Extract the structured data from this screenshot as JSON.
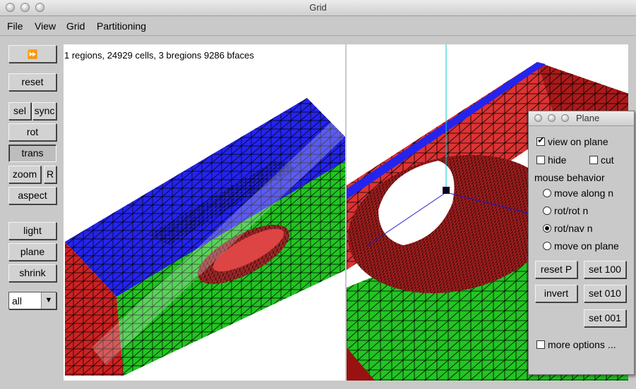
{
  "window": {
    "title": "Grid"
  },
  "menubar": {
    "items": [
      "File",
      "View",
      "Grid",
      "Partitioning"
    ]
  },
  "toolbar": {
    "play_glyph": "⏩",
    "reset": "reset",
    "sel": "sel",
    "sync": "sync",
    "rot": "rot",
    "trans": "trans",
    "zoom": "zoom",
    "r": "R",
    "aspect": "aspect",
    "light": "light",
    "plane": "plane",
    "shrink": "shrink",
    "filter_value": "all",
    "filter_arrow": "▼"
  },
  "viewport_left": {
    "status": "1 regions, 24929 cells, 3 bregions 9286 bfaces"
  },
  "plane_panel": {
    "title": "Plane",
    "view_on_plane": "view on plane",
    "view_on_plane_checked": true,
    "hide": "hide",
    "hide_checked": false,
    "cut": "cut",
    "cut_checked": false,
    "mouse_behavior_label": "mouse behavior",
    "modes": [
      "move along n",
      "rot/rot n",
      "rot/nav n",
      "move on plane"
    ],
    "selected_mode": "rot/nav n",
    "reset_p": "reset P",
    "set_100": "set 100",
    "invert": "invert",
    "set_010": "set 010",
    "set_001": "set 001",
    "more_options": "more options ...",
    "more_options_checked": false
  },
  "colors": {
    "region_blue": "#2424ee",
    "region_green": "#23c423",
    "region_red": "#cc2222",
    "region_dark_red": "#991111"
  },
  "icons": {
    "check": "✔"
  }
}
